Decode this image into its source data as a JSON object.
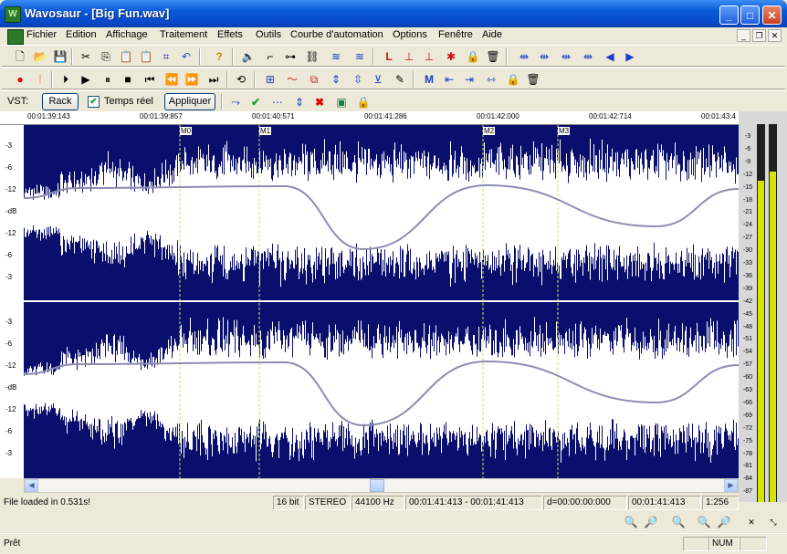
{
  "window": {
    "title": "Wavosaur - [Big Fun.wav]",
    "minimize": "_",
    "maximize": "□",
    "close": "✕"
  },
  "menu": {
    "items": [
      "Fichier",
      "Edition",
      "Affichage",
      "Traitement",
      "Effets",
      "Outils",
      "Courbe d'automation",
      "Options",
      "Fenêtre",
      "Aide"
    ]
  },
  "vst": {
    "label": "VST:",
    "rack_button": "Rack",
    "realtime_label": "Temps réel",
    "realtime_checked": true,
    "apply_button": "Appliquer"
  },
  "ruler": {
    "times": [
      "00:01:39:143",
      "00:01:39:857",
      "00:01:40:571",
      "00:01:41:286",
      "00:01:42:000",
      "00:01:42:714",
      "00:01:43:4"
    ]
  },
  "markers": [
    "M0",
    "M1",
    "M2",
    "M3"
  ],
  "db_scale": {
    "channel_labels": [
      "-3",
      "-6",
      "-12",
      "-dB",
      "-12",
      "-6",
      "-3"
    ]
  },
  "meter": {
    "labels": [
      "-3",
      "-6",
      "-9",
      "-12",
      "-15",
      "-18",
      "-21",
      "-24",
      "-27",
      "-30",
      "-33",
      "-36",
      "-39",
      "-42",
      "-45",
      "-48",
      "-51",
      "-54",
      "-57",
      "-60",
      "-63",
      "-66",
      "-69",
      "-72",
      "-75",
      "-78",
      "-81",
      "-84",
      "-87"
    ],
    "level_color": "#d4e600"
  },
  "info": {
    "message": "File loaded in 0.531s!",
    "bit_depth": "16 bit",
    "channels": "STEREO",
    "sample_rate": "44100 Hz",
    "selection": "00:01:41:413 - 00:01:41:413",
    "duration": "d=00:00:00:000",
    "cursor": "00:01:41:413",
    "zoom": "1:256"
  },
  "status": {
    "text": "Prêt",
    "num": "NUM"
  },
  "colors": {
    "waveform_bg": "#0a0f6e",
    "waveform": "#ffffff",
    "envelope": "#8c8cb4",
    "marker": "#c8e650"
  }
}
